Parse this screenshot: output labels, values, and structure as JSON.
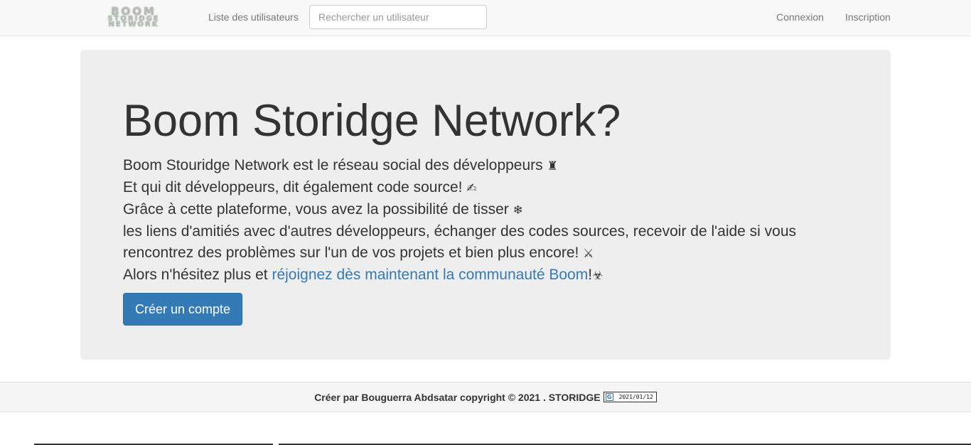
{
  "navbar": {
    "brand": {
      "line1": "BOOM",
      "line2": "STORIDGE",
      "line3": "NETWORK"
    },
    "users_link": "Liste des utilisateurs",
    "search_placeholder": "Rechercher un utilisateur",
    "login_link": "Connexion",
    "signup_link": "Inscription"
  },
  "hero": {
    "title": "Boom Storidge Network?",
    "line1": "Boom Stouridge Network est le réseau social des développeurs ",
    "line1_icon": "♜",
    "line2": "Et qui dit développeurs, dit également code source! ",
    "line2_icon": "✍",
    "line3": "Grâce à cette plateforme, vous avez la possibilité de tisser ",
    "line3_icon": "❄",
    "line4": "les liens d'amitiés avec d'autres développeurs, échanger des codes sources, recevoir de l'aide si vous",
    "line5": "rencontrez des problèmes sur l'un de vos projets et bien plus encore! ",
    "line5_icon": "⚔",
    "line6_prefix": "Alors n'hésitez plus et ",
    "line6_link": "réjoignez dès maintenant la communauté Boom",
    "line6_suffix": "!",
    "line6_icon": "☣",
    "cta_button": "Créer un compte"
  },
  "footer": {
    "text": "Créer par Bouguerra Abdsatar copyright © 2021 . STORIDGE",
    "counter_icon": "G",
    "counter_date": "2021/01/12"
  },
  "colors": {
    "link": "#337ab7",
    "button_bg": "#337ab7",
    "jumbotron_bg": "#eeeeee",
    "navbar_bg": "#f8f8f8"
  }
}
